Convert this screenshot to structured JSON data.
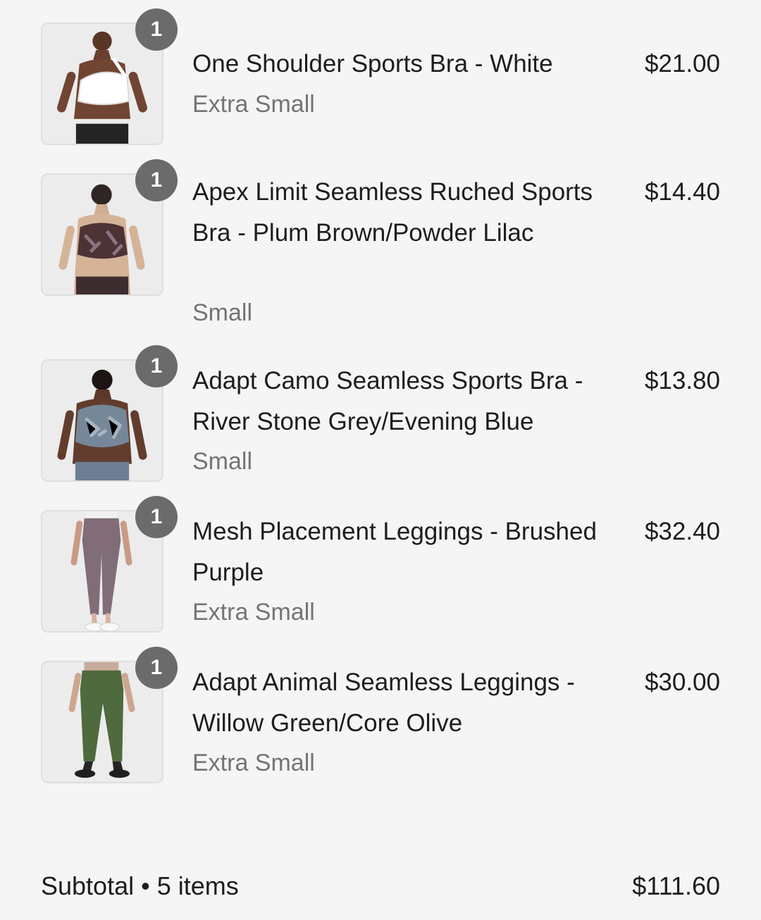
{
  "cart": {
    "items": [
      {
        "quantity": "1",
        "title": "One Shoulder Sports Bra - White",
        "variant": "Extra Small",
        "price": "$21.00",
        "image_icon": "white-sports-bra-product-image"
      },
      {
        "quantity": "1",
        "title": "Apex Limit Seamless Ruched Sports Bra - Plum Brown/Powder Lilac",
        "variant": "Small",
        "price": "$14.40",
        "image_icon": "plum-sports-bra-product-image"
      },
      {
        "quantity": "1",
        "title": "Adapt Camo Seamless Sports Bra - River Stone Grey/Evening Blue",
        "variant": "Small",
        "price": "$13.80",
        "image_icon": "grey-camo-sports-bra-product-image"
      },
      {
        "quantity": "1",
        "title": "Mesh Placement Leggings - Brushed Purple",
        "variant": "Extra Small",
        "price": "$32.40",
        "image_icon": "purple-leggings-product-image"
      },
      {
        "quantity": "1",
        "title": "Adapt Animal Seamless Leggings - Willow Green/Core Olive",
        "variant": "Extra Small",
        "price": "$30.00",
        "image_icon": "green-leggings-product-image"
      }
    ]
  },
  "subtotal": {
    "label": "Subtotal • 5 items",
    "value": "$111.60"
  },
  "colors": {
    "background": "#f5f5f5",
    "text": "#1d1d1d",
    "muted_text": "#747474",
    "badge": "#6b6b6b"
  }
}
